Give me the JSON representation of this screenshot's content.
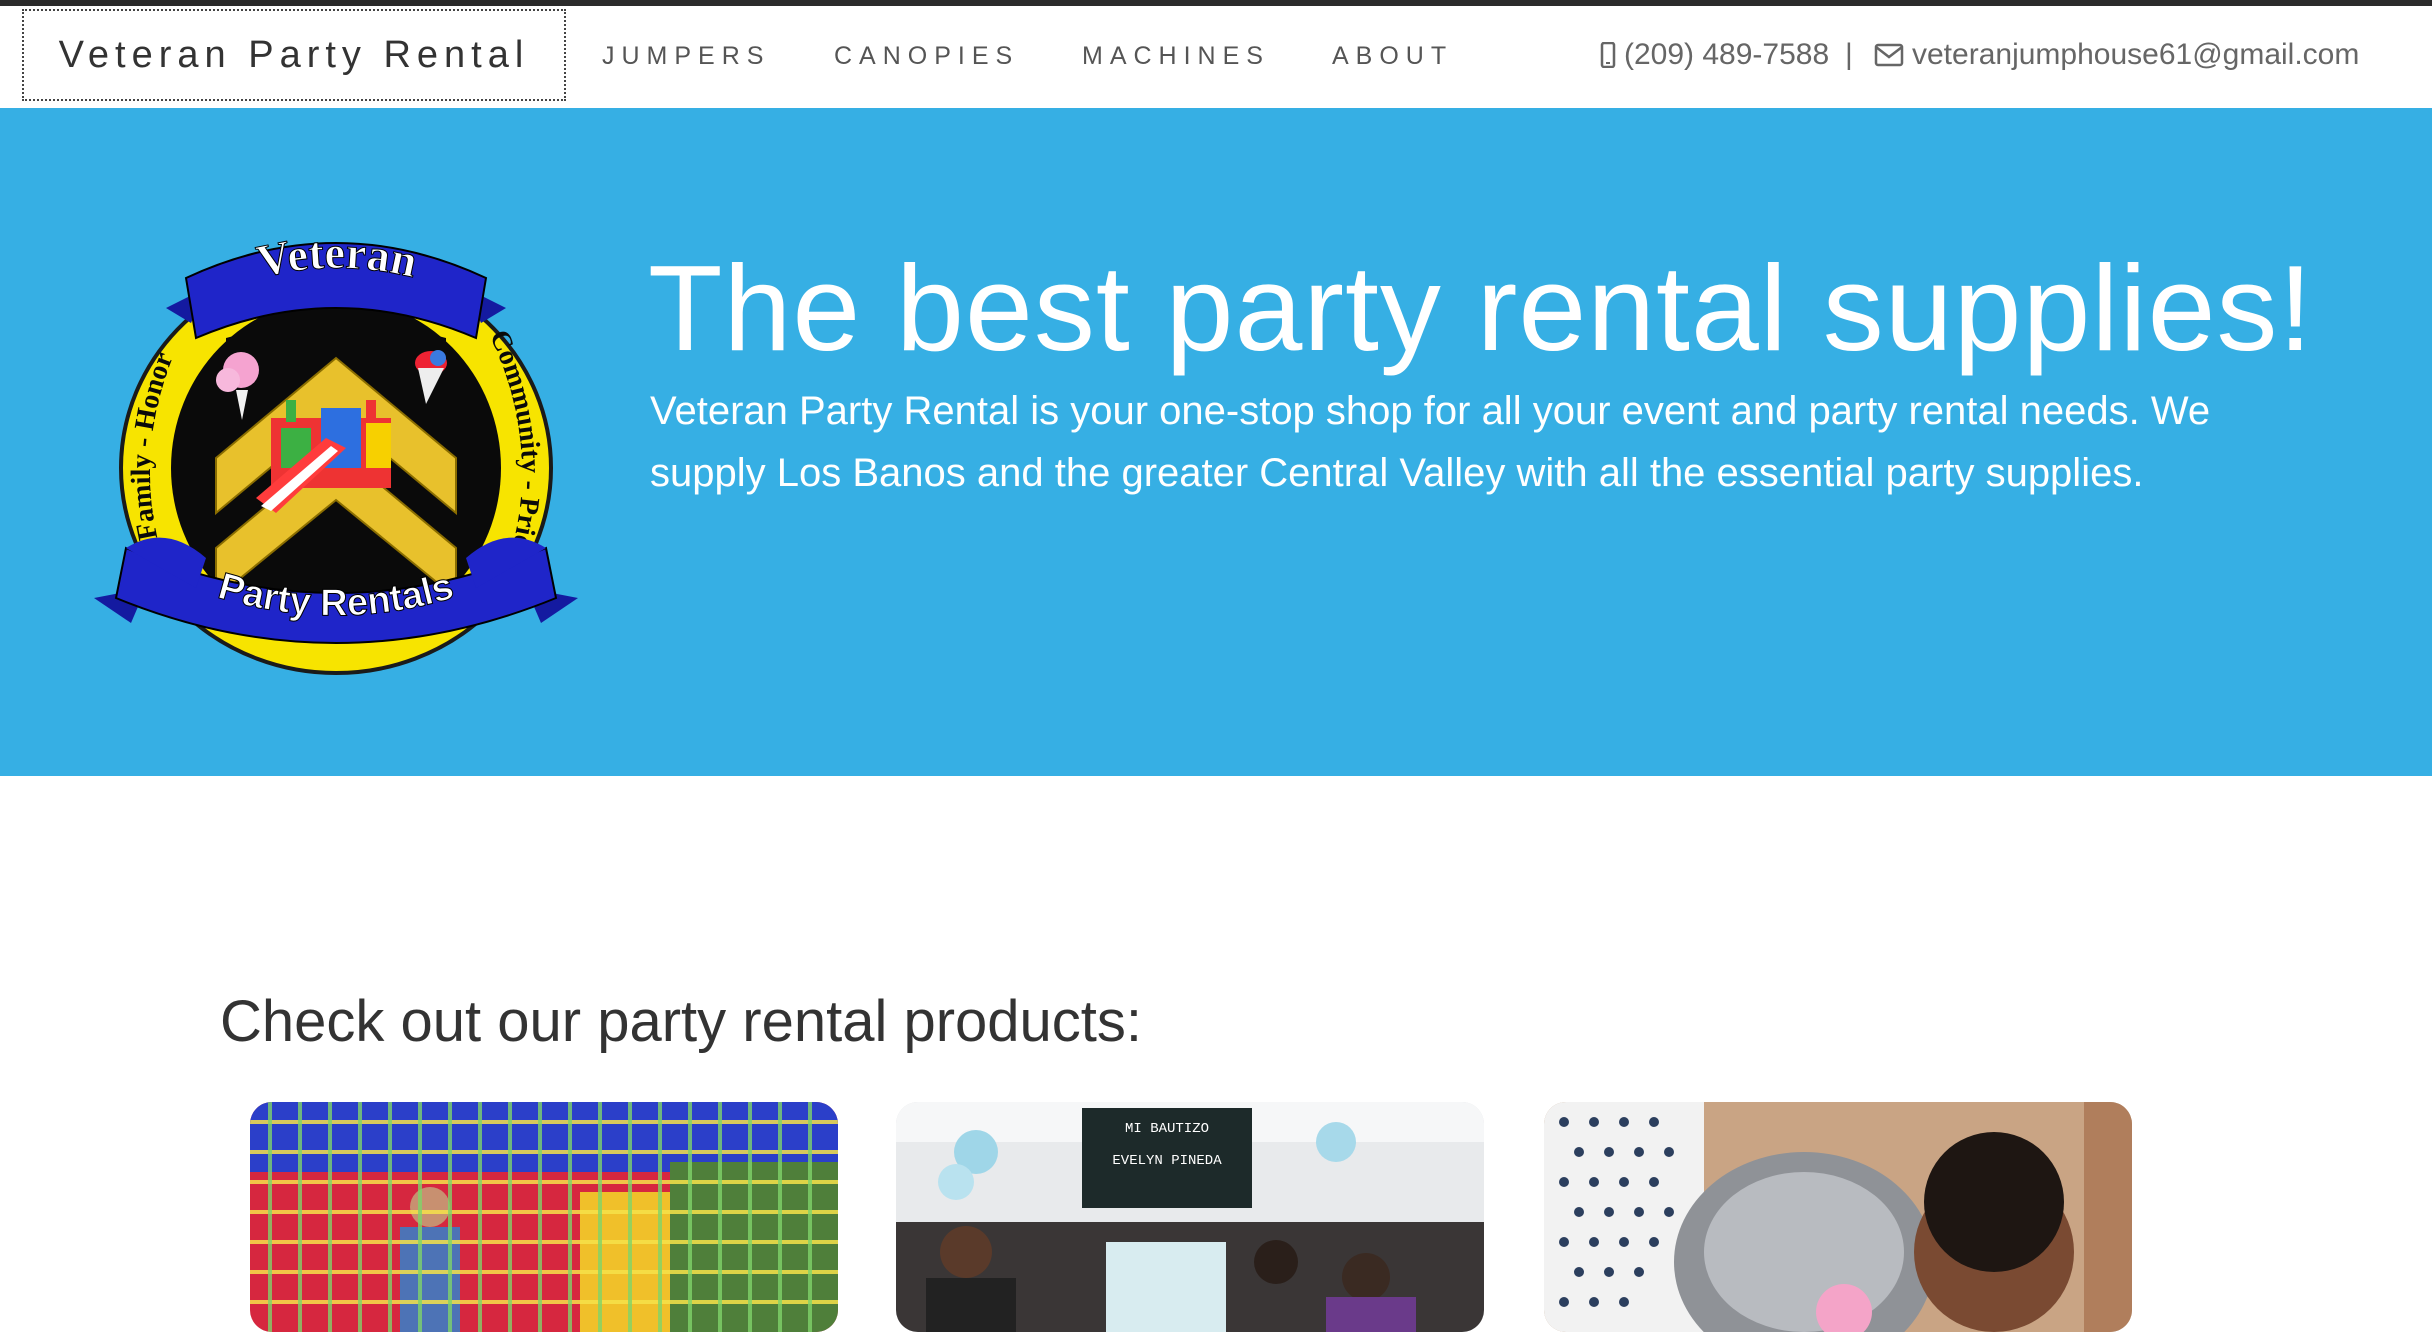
{
  "navbar": {
    "brand": "Veteran Party Rental",
    "links": [
      "JUMPERS",
      "CANOPIES",
      "MACHINES",
      "ABOUT"
    ],
    "phone": "(209) 489-7588",
    "separator": "|",
    "email": "veteranjumphouse61@gmail.com"
  },
  "hero": {
    "logo": {
      "top_banner": "Veteran",
      "left_ring": "Family - Honor",
      "right_ring": "Community - Pride",
      "bottom_banner": "Party Rentals"
    },
    "title": "The best party rental supplies!",
    "description": "Veteran Party Rental is your one-stop shop for all your event and party rental needs. We supply Los Banos and the greater Central Valley with all the essential party supplies."
  },
  "products": {
    "heading": "Check out our party rental products:",
    "cards": [
      {
        "name": "jumper-photo"
      },
      {
        "name": "canopy-photo",
        "sign_line1": "MI BAUTIZO",
        "sign_line2": "EVELYN PINEDA"
      },
      {
        "name": "machine-photo"
      }
    ]
  },
  "colors": {
    "hero_bg": "#36afe4",
    "logo_banner": "#1f25c9",
    "logo_ring": "#f7e400",
    "logo_chevron": "#e8c12c"
  }
}
